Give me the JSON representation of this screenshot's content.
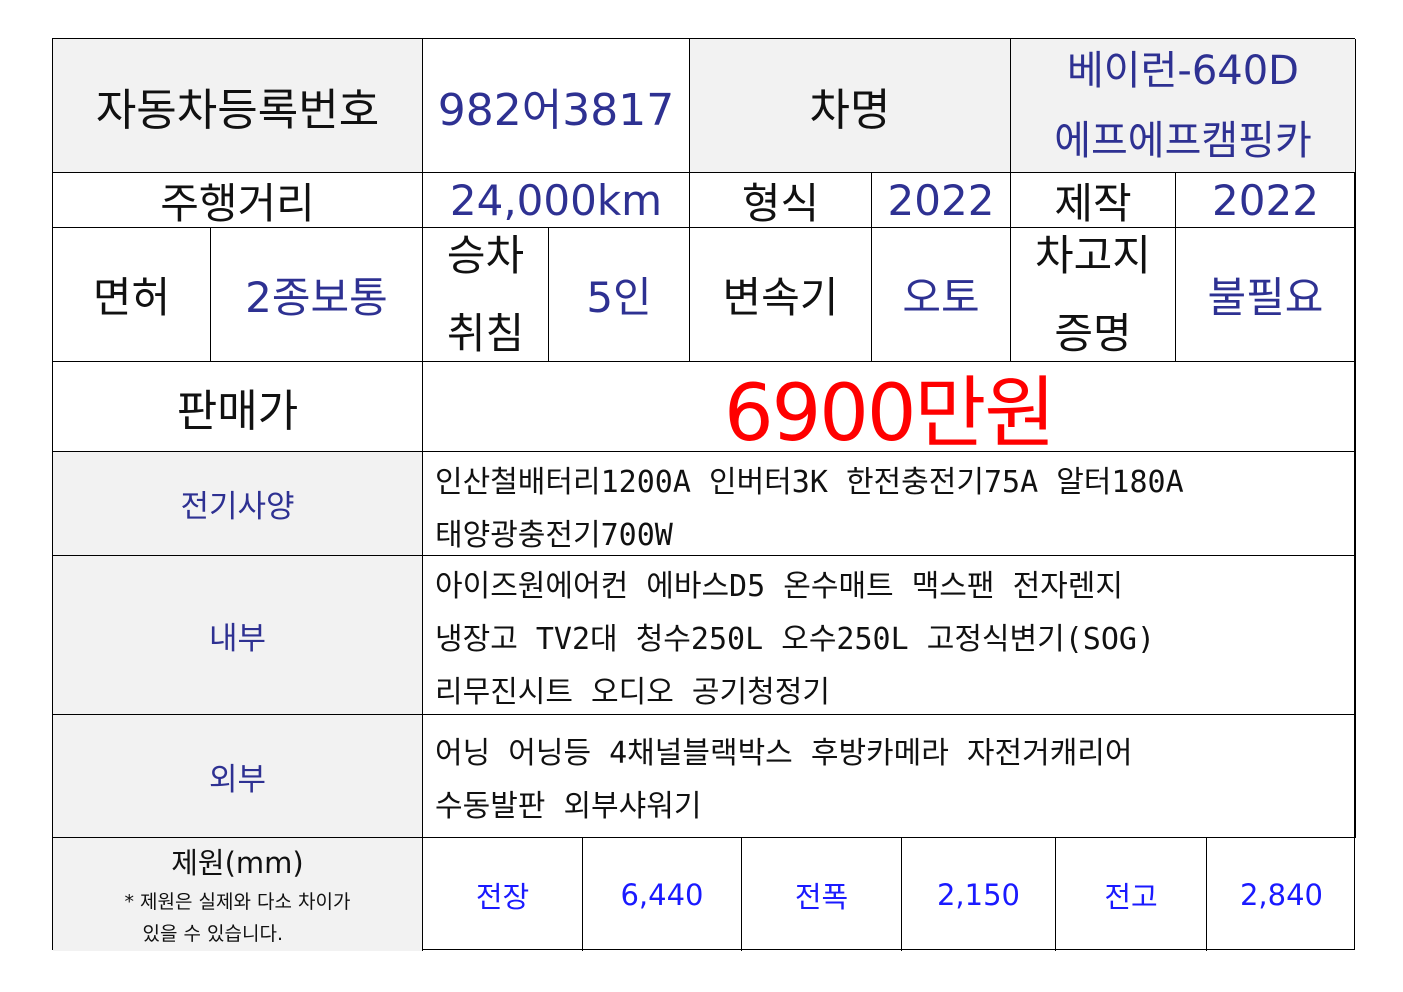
{
  "row1": {
    "reg_label": "자동차등록번호",
    "reg_value": "982어3817",
    "name_label": "차명",
    "name_line1": "베이런-640D",
    "name_line2": "에프에프캠핑카"
  },
  "row2": {
    "mileage_label": "주행거리",
    "mileage_value": "24,000km",
    "model_label": "형식",
    "model_value": "2022",
    "made_label": "제작",
    "made_value": "2022"
  },
  "row3": {
    "license_label": "면허",
    "license_value": "2종보통",
    "capacity_label_1": "승차",
    "capacity_label_2": "취침",
    "capacity_value": "5인",
    "trans_label": "변속기",
    "trans_value": "오토",
    "garage_label_1": "차고지",
    "garage_label_2": "증명",
    "garage_value": "불필요"
  },
  "row4": {
    "price_label": "판매가",
    "price_value": "6900만원"
  },
  "electric": {
    "label": "전기사양",
    "lines": [
      "인산철배터리1200A 인버터3K 한전충전기75A 알터180A",
      "태양광충전기700W"
    ]
  },
  "interior": {
    "label": "내부",
    "lines": [
      "아이즈원에어컨 에바스D5 온수매트 맥스팬 전자렌지",
      "냉장고 TV2대 청수250L 오수250L 고정식변기(SOG)",
      "리무진시트 오디오 공기청정기"
    ]
  },
  "exterior": {
    "label": "외부",
    "lines": [
      "어닝 어닝등 4채널블랙박스 후방카메라 자전거캐리어",
      "수동발판 외부샤워기"
    ]
  },
  "dimensions": {
    "label": "제원(mm)",
    "note_line1": "* 제원은 실제와 다소 차이가",
    "note_line2": "있을 수 있습니다.",
    "length_label": "전장",
    "length_value": "6,440",
    "width_label": "전폭",
    "width_value": "2,150",
    "height_label": "전고",
    "height_value": "2,840"
  },
  "colors": {
    "value_text": "#2e3192",
    "price_text": "#ff0000",
    "dimension_text": "#1a1aff",
    "label_background": "#f2f2f2"
  }
}
